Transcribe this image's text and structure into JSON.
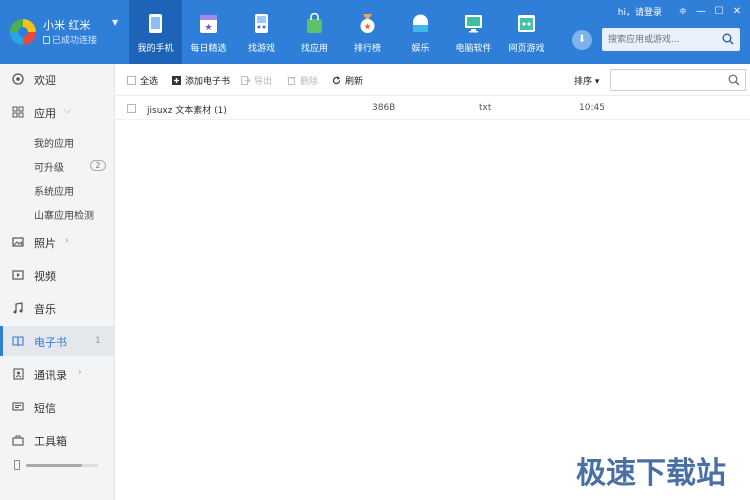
{
  "device": {
    "name": "小米 红米",
    "status": "已成功连接",
    "dropdown_glyph": "▼"
  },
  "nav": {
    "items": [
      {
        "label": "我的手机",
        "icon": "phone-icon",
        "active": true
      },
      {
        "label": "每日精选",
        "icon": "calendar-star-icon",
        "active": false
      },
      {
        "label": "找游戏",
        "icon": "gamepad-icon",
        "active": false
      },
      {
        "label": "找应用",
        "icon": "app-bag-icon",
        "active": false
      },
      {
        "label": "排行榜",
        "icon": "medal-icon",
        "active": false
      },
      {
        "label": "娱乐",
        "icon": "entertainment-icon",
        "active": false
      },
      {
        "label": "电脑软件",
        "icon": "monitor-icon",
        "active": false
      },
      {
        "label": "网页游戏",
        "icon": "web-game-icon",
        "active": false
      }
    ]
  },
  "top_right": {
    "login_text": "hi，请登录",
    "menu_glyph": "≑",
    "minimize_glyph": "—",
    "maximize_glyph": "☐",
    "close_glyph": "✕"
  },
  "top_search": {
    "placeholder": "搜索应用或游戏...",
    "download_glyph": "⬇"
  },
  "sidebar": {
    "welcome": "欢迎",
    "apps": "应用",
    "app_sub": {
      "mine": "我的应用",
      "upgradable": "可升级",
      "upgradable_count": "2",
      "system": "系统应用",
      "copycat": "山寨应用检测"
    },
    "photos": "照片",
    "videos": "视频",
    "music": "音乐",
    "ebooks": "电子书",
    "ebooks_count": "1",
    "contacts": "通讯录",
    "sms": "短信",
    "toolbox": "工具箱",
    "storage_used_fraction": 0.78
  },
  "toolbar": {
    "select_all": "全选",
    "add_ebook": "添加电子书",
    "export": "导出",
    "delete": "删除",
    "refresh": "刷新",
    "sort": "排序 ▾"
  },
  "main_search": {
    "placeholder": ""
  },
  "files": [
    {
      "name": "jisuxz 文本素材 (1)",
      "size": "386B",
      "type": "txt",
      "time": "10:45"
    }
  ],
  "watermark": "极速下载站",
  "colors": {
    "topbar": "#2f7ed8",
    "nav_active": "#1d63b7",
    "sidebar_bg": "#f3f4f6",
    "accent": "#2f7ed8"
  }
}
